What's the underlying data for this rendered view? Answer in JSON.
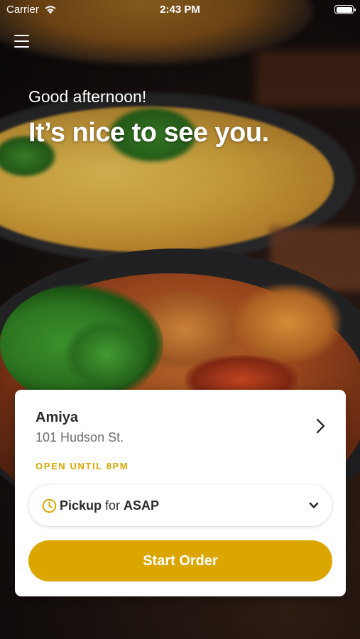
{
  "status_bar": {
    "carrier": "Carrier",
    "time": "2:43 PM",
    "battery_level": 1.0
  },
  "header": {
    "menu_icon": "hamburger-menu-icon",
    "greeting": "Good afternoon!",
    "headline": "It’s nice to see you."
  },
  "location": {
    "name": "Amiya",
    "address": "101 Hudson St.",
    "hours": "OPEN UNTIL 8PM",
    "chevron_icon": "chevron-right-icon"
  },
  "order_mode": {
    "icon": "clock-icon",
    "mode": "Pickup",
    "connector": " for ",
    "time": "ASAP",
    "dropdown_icon": "chevron-down-icon"
  },
  "actions": {
    "start_order": "Start Order"
  },
  "colors": {
    "accent": "#dba600",
    "text_dark": "#2b2b2b",
    "text_muted": "#6d6d6d"
  }
}
